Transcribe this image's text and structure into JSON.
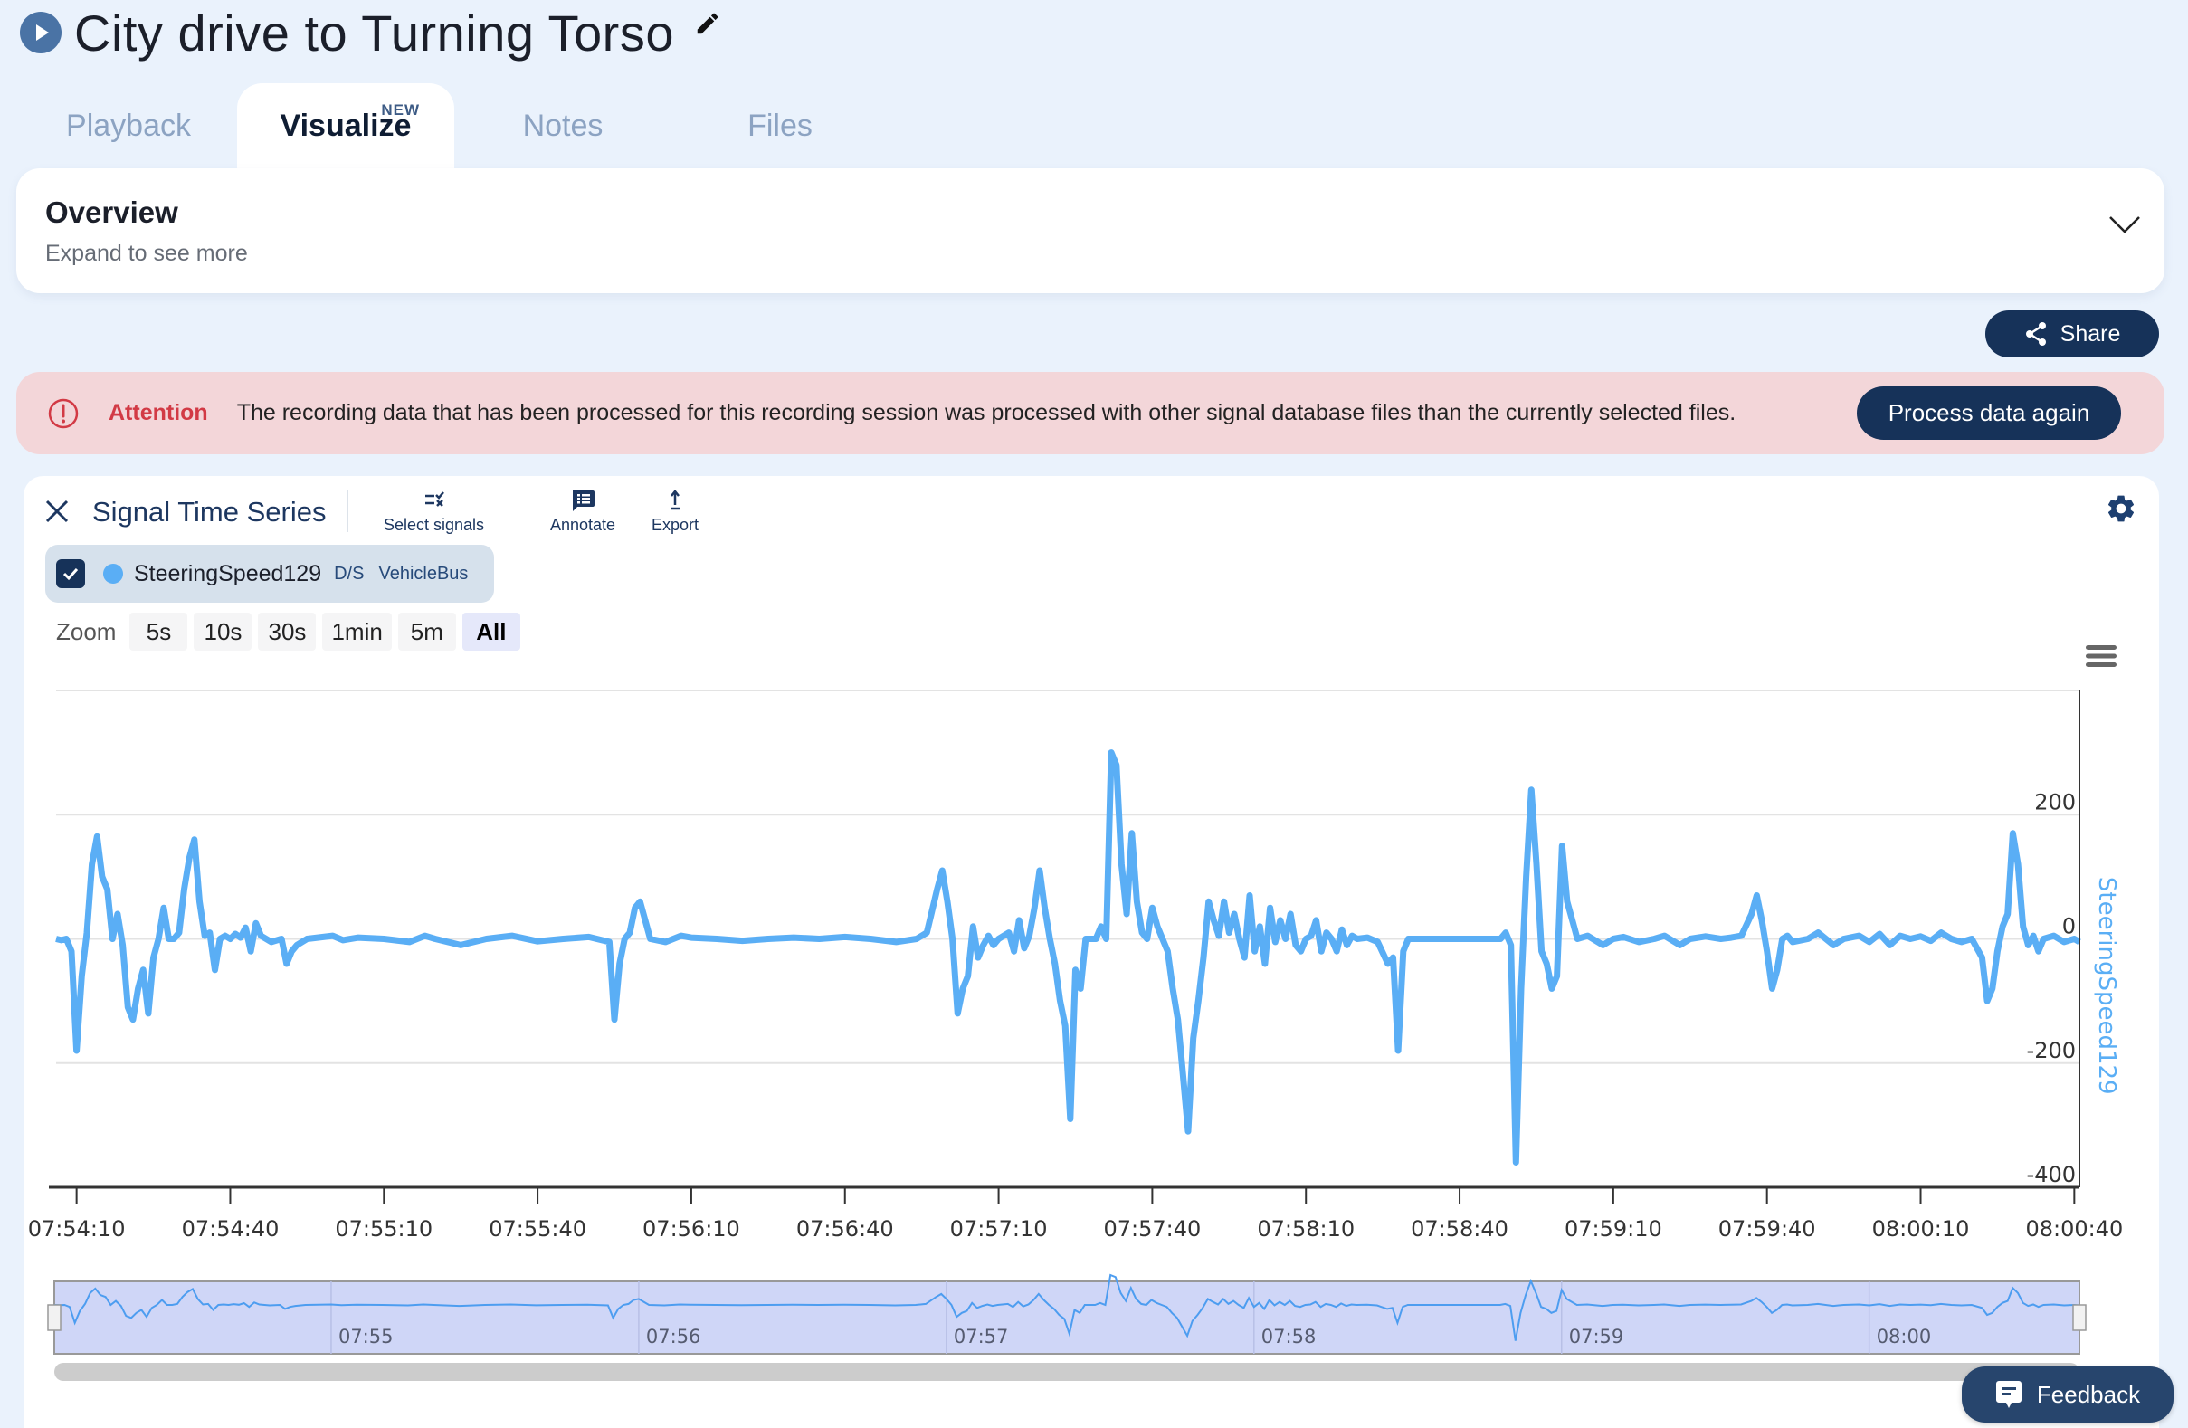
{
  "header": {
    "title": "City drive to Turning Torso",
    "play_icon": "play-circle-icon",
    "edit_icon": "pencil-icon"
  },
  "tabs": [
    {
      "label": "Playback",
      "active": false
    },
    {
      "label": "Visualize",
      "active": true,
      "badge": "NEW"
    },
    {
      "label": "Notes",
      "active": false
    },
    {
      "label": "Files",
      "active": false
    }
  ],
  "overview": {
    "title": "Overview",
    "subtitle": "Expand to see more",
    "toggle_icon": "chevron-down-icon"
  },
  "share": {
    "label": "Share",
    "icon": "share-icon"
  },
  "alert": {
    "title": "Attention",
    "message": "The recording data that has been processed for this recording session was processed with other signal database files than the currently selected files.",
    "action_label": "Process data again",
    "icon": "alert-circle-icon",
    "color": "#d23a45"
  },
  "panel": {
    "title": "Signal Time Series",
    "tools": [
      {
        "label": "Select signals",
        "icon": "select-signals-icon"
      },
      {
        "label": "Annotate",
        "icon": "comment-icon"
      },
      {
        "label": "Export",
        "icon": "upload-icon"
      }
    ],
    "signal": {
      "checked": true,
      "name": "SteeringSpeed129",
      "unit": "D/S",
      "bus": "VehicleBus",
      "color": "#5aaef5"
    },
    "zoom": {
      "label": "Zoom",
      "options": [
        "5s",
        "10s",
        "30s",
        "1min",
        "5m",
        "All"
      ],
      "selected": "All"
    }
  },
  "feedback": {
    "label": "Feedback"
  },
  "chart_data": {
    "type": "line",
    "title": "",
    "xlabel": "",
    "ylabel": "SteeringSpeed129",
    "y_axis_side": "right",
    "ylim": [
      -400,
      400
    ],
    "yticks": [
      -400,
      -200,
      0,
      200
    ],
    "grid": true,
    "x_start": "07:54:06",
    "x_end": "08:00:41",
    "xtick_labels": [
      "07:54:10",
      "07:54:40",
      "07:55:10",
      "07:55:40",
      "07:56:10",
      "07:56:40",
      "07:57:10",
      "07:57:40",
      "07:58:10",
      "07:58:40",
      "07:59:10",
      "07:59:40",
      "08:00:10",
      "08:00:40"
    ],
    "navigator_labels": [
      "07:55",
      "07:56",
      "07:57",
      "07:58",
      "07:59",
      "08:00"
    ],
    "series": [
      {
        "name": "SteeringSpeed129",
        "color": "#5aaef5",
        "x_unit": "seconds after 07:54:00",
        "points": [
          [
            6,
            0
          ],
          [
            7,
            -2
          ],
          [
            8,
            0
          ],
          [
            9,
            -20
          ],
          [
            10,
            -180
          ],
          [
            11,
            -60
          ],
          [
            12,
            10
          ],
          [
            13,
            120
          ],
          [
            14,
            165
          ],
          [
            15,
            100
          ],
          [
            16,
            80
          ],
          [
            17,
            0
          ],
          [
            18,
            40
          ],
          [
            19,
            -10
          ],
          [
            20,
            -110
          ],
          [
            21,
            -130
          ],
          [
            22,
            -80
          ],
          [
            23,
            -50
          ],
          [
            24,
            -120
          ],
          [
            25,
            -30
          ],
          [
            26,
            0
          ],
          [
            27,
            50
          ],
          [
            28,
            0
          ],
          [
            29,
            0
          ],
          [
            30,
            10
          ],
          [
            31,
            80
          ],
          [
            32,
            130
          ],
          [
            33,
            160
          ],
          [
            34,
            60
          ],
          [
            35,
            5
          ],
          [
            36,
            10
          ],
          [
            37,
            -50
          ],
          [
            38,
            0
          ],
          [
            39,
            5
          ],
          [
            40,
            0
          ],
          [
            41,
            8
          ],
          [
            42,
            2
          ],
          [
            43,
            18
          ],
          [
            44,
            -20
          ],
          [
            45,
            25
          ],
          [
            46,
            5
          ],
          [
            47,
            0
          ],
          [
            48,
            -5
          ],
          [
            50,
            0
          ],
          [
            51,
            -40
          ],
          [
            52,
            -20
          ],
          [
            53,
            -10
          ],
          [
            55,
            0
          ],
          [
            60,
            5
          ],
          [
            62,
            -2
          ],
          [
            65,
            2
          ],
          [
            70,
            0
          ],
          [
            75,
            -5
          ],
          [
            78,
            5
          ],
          [
            80,
            0
          ],
          [
            85,
            -10
          ],
          [
            90,
            0
          ],
          [
            95,
            5
          ],
          [
            100,
            -4
          ],
          [
            105,
            0
          ],
          [
            110,
            3
          ],
          [
            114,
            -5
          ],
          [
            115,
            -130
          ],
          [
            116,
            -40
          ],
          [
            117,
            0
          ],
          [
            118,
            10
          ],
          [
            119,
            50
          ],
          [
            120,
            60
          ],
          [
            121,
            30
          ],
          [
            122,
            0
          ],
          [
            125,
            -5
          ],
          [
            128,
            5
          ],
          [
            130,
            2
          ],
          [
            135,
            0
          ],
          [
            140,
            -3
          ],
          [
            145,
            0
          ],
          [
            150,
            2
          ],
          [
            155,
            0
          ],
          [
            160,
            3
          ],
          [
            165,
            0
          ],
          [
            170,
            -5
          ],
          [
            174,
            0
          ],
          [
            176,
            10
          ],
          [
            178,
            80
          ],
          [
            179,
            110
          ],
          [
            180,
            60
          ],
          [
            181,
            0
          ],
          [
            182,
            -120
          ],
          [
            183,
            -80
          ],
          [
            184,
            -60
          ],
          [
            185,
            20
          ],
          [
            186,
            -30
          ],
          [
            187,
            -10
          ],
          [
            188,
            5
          ],
          [
            189,
            -10
          ],
          [
            190,
            0
          ],
          [
            192,
            10
          ],
          [
            193,
            -20
          ],
          [
            194,
            30
          ],
          [
            195,
            -15
          ],
          [
            196,
            5
          ],
          [
            197,
            50
          ],
          [
            198,
            110
          ],
          [
            199,
            50
          ],
          [
            200,
            0
          ],
          [
            201,
            -40
          ],
          [
            202,
            -100
          ],
          [
            203,
            -140
          ],
          [
            204,
            -290
          ],
          [
            205,
            -50
          ],
          [
            206,
            -80
          ],
          [
            207,
            0
          ],
          [
            208,
            0
          ],
          [
            209,
            0
          ],
          [
            210,
            20
          ],
          [
            211,
            0
          ],
          [
            212,
            300
          ],
          [
            213,
            280
          ],
          [
            214,
            120
          ],
          [
            215,
            40
          ],
          [
            216,
            170
          ],
          [
            217,
            60
          ],
          [
            218,
            10
          ],
          [
            219,
            0
          ],
          [
            220,
            50
          ],
          [
            221,
            20
          ],
          [
            222,
            0
          ],
          [
            223,
            -20
          ],
          [
            224,
            -80
          ],
          [
            225,
            -130
          ],
          [
            226,
            -220
          ],
          [
            227,
            -310
          ],
          [
            228,
            -160
          ],
          [
            229,
            -100
          ],
          [
            230,
            -30
          ],
          [
            231,
            60
          ],
          [
            232,
            30
          ],
          [
            233,
            5
          ],
          [
            234,
            60
          ],
          [
            235,
            10
          ],
          [
            236,
            40
          ],
          [
            237,
            0
          ],
          [
            238,
            -30
          ],
          [
            239,
            70
          ],
          [
            240,
            -20
          ],
          [
            241,
            20
          ],
          [
            242,
            -40
          ],
          [
            243,
            50
          ],
          [
            244,
            -5
          ],
          [
            245,
            30
          ],
          [
            246,
            0
          ],
          [
            247,
            40
          ],
          [
            248,
            -10
          ],
          [
            249,
            -20
          ],
          [
            250,
            0
          ],
          [
            251,
            5
          ],
          [
            252,
            30
          ],
          [
            253,
            -20
          ],
          [
            254,
            10
          ],
          [
            255,
            0
          ],
          [
            256,
            -20
          ],
          [
            257,
            15
          ],
          [
            258,
            -10
          ],
          [
            259,
            5
          ],
          [
            260,
            0
          ],
          [
            262,
            2
          ],
          [
            264,
            -5
          ],
          [
            266,
            -40
          ],
          [
            267,
            -30
          ],
          [
            268,
            -180
          ],
          [
            269,
            -20
          ],
          [
            270,
            0
          ],
          [
            272,
            0
          ],
          [
            275,
            0
          ],
          [
            280,
            0
          ],
          [
            285,
            0
          ],
          [
            288,
            0
          ],
          [
            289,
            10
          ],
          [
            290,
            -10
          ],
          [
            291,
            -360
          ],
          [
            292,
            -80
          ],
          [
            293,
            100
          ],
          [
            294,
            240
          ],
          [
            295,
            120
          ],
          [
            296,
            -20
          ],
          [
            297,
            -40
          ],
          [
            298,
            -80
          ],
          [
            299,
            -60
          ],
          [
            300,
            150
          ],
          [
            301,
            60
          ],
          [
            302,
            30
          ],
          [
            303,
            0
          ],
          [
            305,
            5
          ],
          [
            308,
            -10
          ],
          [
            310,
            0
          ],
          [
            312,
            3
          ],
          [
            315,
            -5
          ],
          [
            318,
            0
          ],
          [
            320,
            5
          ],
          [
            323,
            -10
          ],
          [
            325,
            0
          ],
          [
            328,
            4
          ],
          [
            331,
            0
          ],
          [
            333,
            2
          ],
          [
            335,
            5
          ],
          [
            337,
            40
          ],
          [
            338,
            70
          ],
          [
            339,
            30
          ],
          [
            340,
            -20
          ],
          [
            341,
            -80
          ],
          [
            342,
            -50
          ],
          [
            343,
            0
          ],
          [
            344,
            5
          ],
          [
            345,
            -5
          ],
          [
            348,
            0
          ],
          [
            350,
            10
          ],
          [
            353,
            -10
          ],
          [
            355,
            0
          ],
          [
            358,
            5
          ],
          [
            360,
            -5
          ],
          [
            362,
            8
          ],
          [
            364,
            -10
          ],
          [
            366,
            5
          ],
          [
            368,
            0
          ],
          [
            370,
            4
          ],
          [
            372,
            -3
          ],
          [
            374,
            10
          ],
          [
            376,
            0
          ],
          [
            378,
            -5
          ],
          [
            380,
            0
          ],
          [
            382,
            -30
          ],
          [
            383,
            -100
          ],
          [
            384,
            -80
          ],
          [
            385,
            -20
          ],
          [
            386,
            20
          ],
          [
            387,
            40
          ],
          [
            388,
            170
          ],
          [
            389,
            120
          ],
          [
            390,
            20
          ],
          [
            391,
            -10
          ],
          [
            392,
            5
          ],
          [
            393,
            -20
          ],
          [
            394,
            0
          ],
          [
            396,
            5
          ],
          [
            398,
            -5
          ],
          [
            400,
            0
          ],
          [
            401,
            -5
          ]
        ]
      }
    ]
  }
}
